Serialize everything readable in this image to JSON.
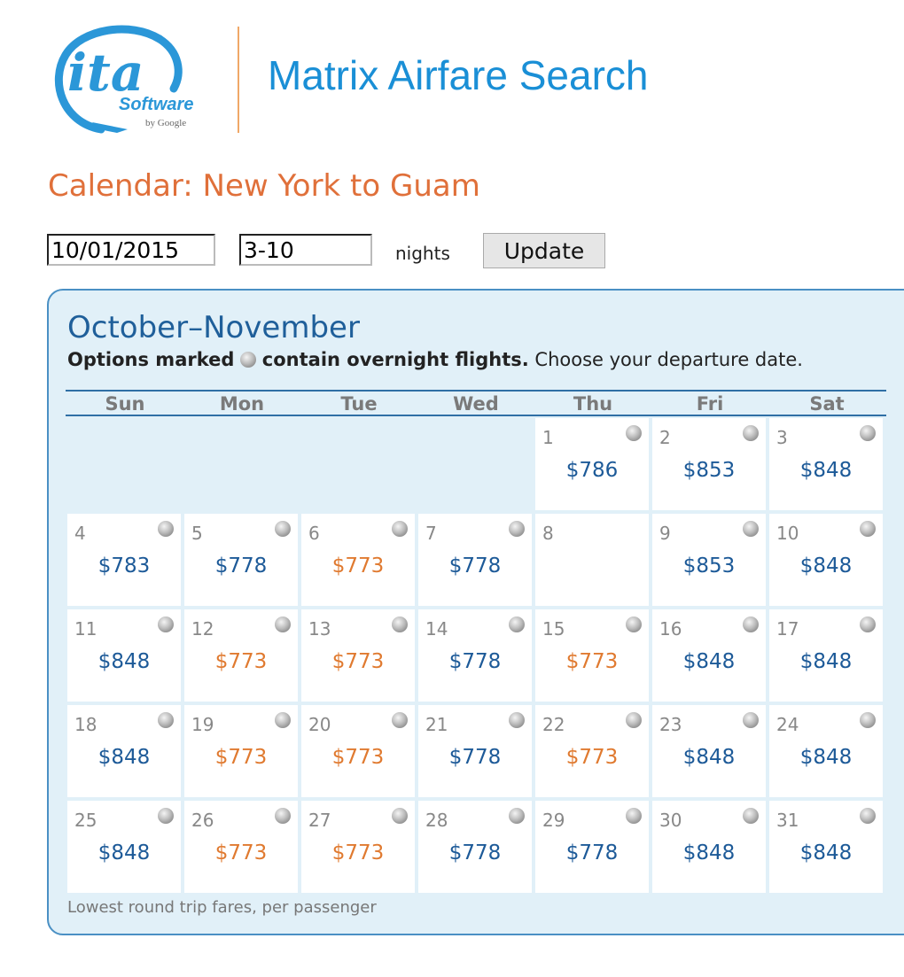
{
  "header": {
    "logo_text": "ita",
    "logo_sub": "Software",
    "logo_by": "by Google",
    "app_title": "Matrix Airfare Search"
  },
  "page_title": "Calendar: New York to Guam",
  "controls": {
    "start_date": "10/01/2015",
    "nights_range": "3-10",
    "nights_label": "nights",
    "update_label": "Update"
  },
  "calendar": {
    "title": "October–November",
    "note_bold_1": "Options marked",
    "note_bold_2": "contain overnight flights.",
    "note_rest": "Choose your departure date.",
    "weekdays": [
      "Sun",
      "Mon",
      "Tue",
      "Wed",
      "Thu",
      "Fri",
      "Sat"
    ],
    "days": [
      {
        "day": "1",
        "price": "$786",
        "color": "blue",
        "overnight": true
      },
      {
        "day": "2",
        "price": "$853",
        "color": "blue",
        "overnight": true
      },
      {
        "day": "3",
        "price": "$848",
        "color": "blue",
        "overnight": true
      },
      {
        "day": "4",
        "price": "$783",
        "color": "blue",
        "overnight": true
      },
      {
        "day": "5",
        "price": "$778",
        "color": "blue",
        "overnight": true
      },
      {
        "day": "6",
        "price": "$773",
        "color": "orange",
        "overnight": true
      },
      {
        "day": "7",
        "price": "$778",
        "color": "blue",
        "overnight": true
      },
      {
        "day": "8",
        "price": "",
        "color": "blue",
        "overnight": false
      },
      {
        "day": "9",
        "price": "$853",
        "color": "blue",
        "overnight": true
      },
      {
        "day": "10",
        "price": "$848",
        "color": "blue",
        "overnight": true
      },
      {
        "day": "11",
        "price": "$848",
        "color": "blue",
        "overnight": true
      },
      {
        "day": "12",
        "price": "$773",
        "color": "orange",
        "overnight": true
      },
      {
        "day": "13",
        "price": "$773",
        "color": "orange",
        "overnight": true
      },
      {
        "day": "14",
        "price": "$778",
        "color": "blue",
        "overnight": true
      },
      {
        "day": "15",
        "price": "$773",
        "color": "orange",
        "overnight": true
      },
      {
        "day": "16",
        "price": "$848",
        "color": "blue",
        "overnight": true
      },
      {
        "day": "17",
        "price": "$848",
        "color": "blue",
        "overnight": true
      },
      {
        "day": "18",
        "price": "$848",
        "color": "blue",
        "overnight": true
      },
      {
        "day": "19",
        "price": "$773",
        "color": "orange",
        "overnight": true
      },
      {
        "day": "20",
        "price": "$773",
        "color": "orange",
        "overnight": true
      },
      {
        "day": "21",
        "price": "$778",
        "color": "blue",
        "overnight": true
      },
      {
        "day": "22",
        "price": "$773",
        "color": "orange",
        "overnight": true
      },
      {
        "day": "23",
        "price": "$848",
        "color": "blue",
        "overnight": true
      },
      {
        "day": "24",
        "price": "$848",
        "color": "blue",
        "overnight": true
      },
      {
        "day": "25",
        "price": "$848",
        "color": "blue",
        "overnight": true
      },
      {
        "day": "26",
        "price": "$773",
        "color": "orange",
        "overnight": true
      },
      {
        "day": "27",
        "price": "$773",
        "color": "orange",
        "overnight": true
      },
      {
        "day": "28",
        "price": "$778",
        "color": "blue",
        "overnight": true
      },
      {
        "day": "29",
        "price": "$778",
        "color": "blue",
        "overnight": true
      },
      {
        "day": "30",
        "price": "$848",
        "color": "blue",
        "overnight": true
      },
      {
        "day": "31",
        "price": "$848",
        "color": "blue",
        "overnight": true
      }
    ],
    "footer": "Lowest round trip fares, per passenger"
  },
  "colors": {
    "brand_blue": "#1a8fd6",
    "title_orange": "#e0703a",
    "price_blue": "#1d5a98",
    "price_orange": "#e07a30",
    "panel_bg": "#e1f0f8"
  }
}
